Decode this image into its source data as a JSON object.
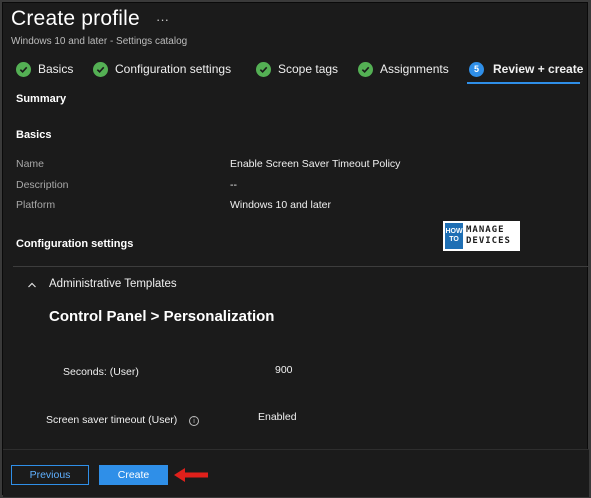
{
  "header": {
    "title": "Create profile",
    "more": "···",
    "subtitle": "Windows 10 and later - Settings catalog"
  },
  "tabs": [
    {
      "label": "Basics",
      "state": "done"
    },
    {
      "label": "Configuration settings",
      "state": "done"
    },
    {
      "label": "Scope tags",
      "state": "done"
    },
    {
      "label": "Assignments",
      "state": "done"
    },
    {
      "label": "Review + create",
      "state": "active",
      "step": "5"
    }
  ],
  "summary": {
    "heading": "Summary",
    "basics_heading": "Basics",
    "fields": [
      {
        "label": "Name",
        "value": "Enable Screen Saver Timeout Policy"
      },
      {
        "label": "Description",
        "value": "--"
      },
      {
        "label": "Platform",
        "value": "Windows 10 and later"
      }
    ],
    "config_heading": "Configuration settings"
  },
  "watermark": {
    "line1": "HOW",
    "line2": "TO",
    "word1": "MANAGE",
    "word2": "DEVICES"
  },
  "config": {
    "group_title": "Administrative Templates",
    "category_title": "Control Panel > Personalization",
    "settings": [
      {
        "label": "Seconds: (User)",
        "value": "900"
      },
      {
        "label": "Screen saver timeout (User)",
        "value": "Enabled"
      }
    ]
  },
  "footer": {
    "previous_label": "Previous",
    "create_label": "Create"
  },
  "colors": {
    "accent": "#2f8fe8",
    "check": "#54b054",
    "arrow": "#e0201b",
    "background": "#1b1b1b"
  }
}
